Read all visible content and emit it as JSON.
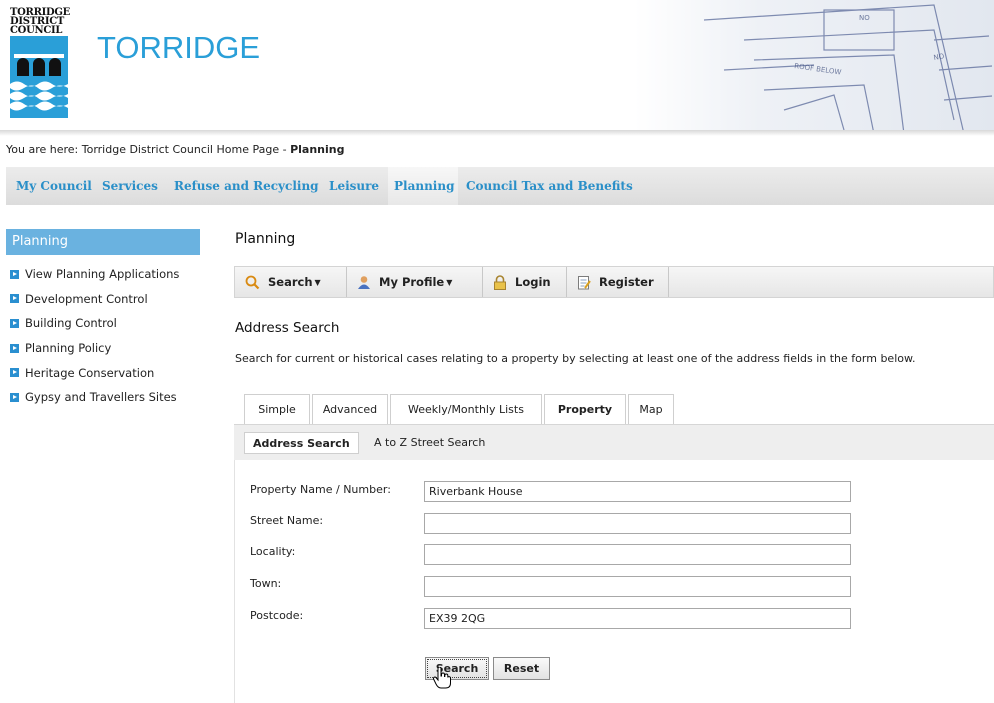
{
  "header": {
    "logo_lines": [
      "TORRIDGE",
      "DISTRICT",
      "COUNCIL"
    ],
    "site_title": "TORRIDGE"
  },
  "breadcrumb": {
    "prefix": "You are here:",
    "home": "Torridge District Council Home Page",
    "separator": "-",
    "current": "Planning"
  },
  "mainnav": {
    "items": [
      {
        "label": "My Council"
      },
      {
        "label": "Services"
      },
      {
        "label": "Refuse and Recycling"
      },
      {
        "label": "Leisure"
      },
      {
        "label": "Planning"
      },
      {
        "label": "Council Tax and Benefits"
      }
    ],
    "active": "Planning"
  },
  "sidebar": {
    "heading": "Planning",
    "items": [
      {
        "label": "View Planning Applications"
      },
      {
        "label": "Development Control"
      },
      {
        "label": "Building Control"
      },
      {
        "label": "Planning Policy"
      },
      {
        "label": "Heritage Conservation"
      },
      {
        "label": "Gypsy and Travellers Sites"
      }
    ]
  },
  "main": {
    "heading": "Planning",
    "toolbar": {
      "search": "Search",
      "profile": "My Profile",
      "login": "Login",
      "register": "Register"
    },
    "section_heading": "Address Search",
    "intro": "Search for current or historical cases relating to a property by selecting at least one of the address fields in the form below.",
    "tabs": [
      {
        "label": "Simple"
      },
      {
        "label": "Advanced"
      },
      {
        "label": "Weekly/Monthly Lists"
      },
      {
        "label": "Property"
      },
      {
        "label": "Map"
      }
    ],
    "active_tab": "Property",
    "subtabs": [
      {
        "label": "Address Search"
      },
      {
        "label": "A to Z Street Search"
      }
    ],
    "active_subtab": "Address Search",
    "form": {
      "property_label": "Property Name / Number:",
      "property_value": "Riverbank House",
      "street_label": "Street Name:",
      "street_value": "",
      "locality_label": "Locality:",
      "locality_value": "",
      "town_label": "Town:",
      "town_value": "",
      "postcode_label": "Postcode:",
      "postcode_value": "EX39 2QG",
      "search_button": "Search",
      "reset_button": "Reset"
    }
  },
  "colors": {
    "brand_blue": "#2a9fd8",
    "nav_link": "#2a8fc8",
    "sidebar_head": "#6ab2e0"
  }
}
